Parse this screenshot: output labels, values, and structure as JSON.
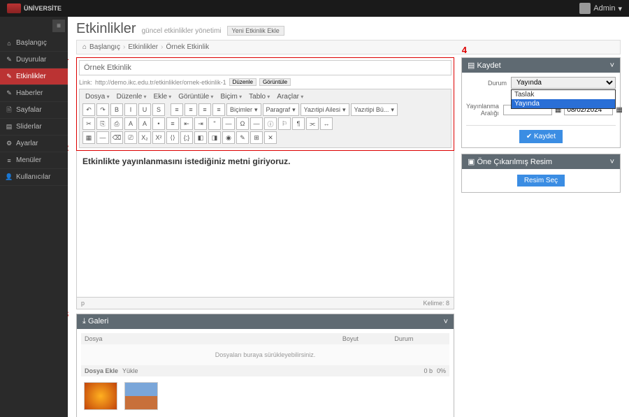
{
  "topbar": {
    "brand": "ÜNİVERSİTE",
    "user": "Admin"
  },
  "sidebar": {
    "items": [
      {
        "icon": "⌂",
        "label": "Başlangıç"
      },
      {
        "icon": "✎",
        "label": "Duyurular"
      },
      {
        "icon": "✎",
        "label": "Etkinlikler",
        "active": true
      },
      {
        "icon": "✎",
        "label": "Haberler"
      },
      {
        "icon": "🗎",
        "label": "Sayfalar"
      },
      {
        "icon": "▤",
        "label": "Sliderlar"
      },
      {
        "icon": "⚙",
        "label": "Ayarlar"
      },
      {
        "icon": "≡",
        "label": "Menüler"
      },
      {
        "icon": "👤",
        "label": "Kullanıcılar"
      }
    ]
  },
  "page": {
    "title": "Etkinlikler",
    "subtitle": "güncel etkinlikler yönetimi",
    "new_btn": "Yeni Etkinlik Ekle"
  },
  "breadcrumb": {
    "home": "Başlangıç",
    "section": "Etkinlikler",
    "current": "Örnek Etkinlik"
  },
  "markers": {
    "m1": "1",
    "m2": "2",
    "m3": "3",
    "m4": "4"
  },
  "form": {
    "title_value": "Örnek Etkinlik",
    "link_label": "Link:",
    "link_url": "http://demo.ikc.edu.tr/etkinlikler/ornek-etkinlik-1",
    "link_edit": "Düzenle",
    "link_view": "Görüntüle"
  },
  "editor": {
    "menus": [
      "Dosya",
      "Düzenle",
      "Ekle",
      "Görüntüle",
      "Biçim",
      "Tablo",
      "Araçlar"
    ],
    "row1_btns": [
      "↶",
      "↷",
      "B",
      "I",
      "U",
      "S"
    ],
    "align_btns": [
      "≡",
      "≡",
      "≡",
      "≡"
    ],
    "selects": {
      "bicim": "Biçimler",
      "para": "Paragraf",
      "font": "Yazıtipi Ailesi",
      "size": "Yazıtipi Bü..."
    },
    "row2_btns": [
      "✂",
      "⎘",
      "⎙",
      "A",
      "A",
      "•",
      "≡",
      "⇤",
      "⇥",
      "\"",
      "—",
      "Ω",
      "—",
      "ⓘ",
      "⚐",
      "¶",
      "⫘",
      "↔"
    ],
    "row3_btns": [
      "▦",
      "—",
      "⌫",
      "⎚",
      "X₂",
      "X²",
      "⟨⟩",
      "{;}",
      "◧",
      "◨",
      "◉",
      "✎",
      "⊞",
      "✕"
    ],
    "content": "Etkinlikte yayınlanmasını istediğiniz metni giriyoruz.",
    "status_path": "p",
    "status_words": "Kelime: 8"
  },
  "gallery": {
    "title": "Galeri",
    "col_file": "Dosya",
    "col_size": "Boyut",
    "col_status": "Durum",
    "drop_text": "Dosyaları buraya sürükleyebilirsiniz.",
    "add_file": "Dosya Ekle",
    "upload": "Yükle",
    "total_size": "0 b",
    "pct": "0%"
  },
  "kaydet": {
    "title": "Kaydet",
    "durum_label": "Durum",
    "durum_value": "Yayında",
    "opt_taslak": "Taslak",
    "opt_yayinda": "Yayında",
    "range_label": "Yayınlanma Aralığı",
    "date_end": "08/02/2024",
    "save_btn": "✔ Kaydet"
  },
  "resim": {
    "title": "Öne Çıkarılmış Resim",
    "btn": "Resim Seç"
  }
}
